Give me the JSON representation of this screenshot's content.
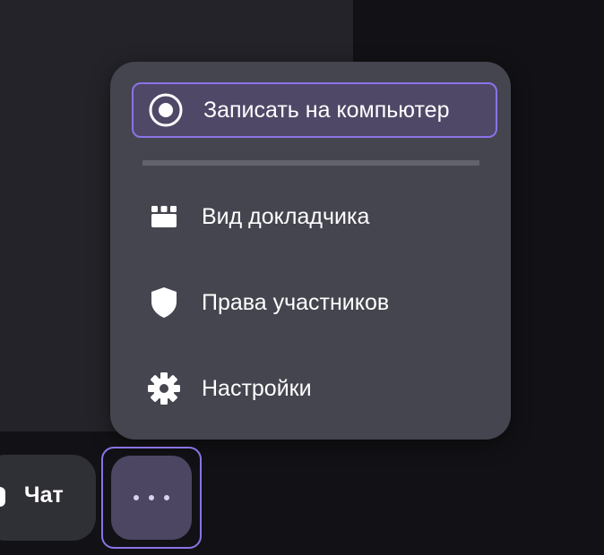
{
  "menu": {
    "items": [
      {
        "label": "Записать на компьютер",
        "icon": "record-icon",
        "active": true
      },
      {
        "label": "Вид докладчика",
        "icon": "speaker-view-icon"
      },
      {
        "label": "Права участников",
        "icon": "shield-icon"
      },
      {
        "label": "Настройки",
        "icon": "gear-icon"
      }
    ]
  },
  "toolbar": {
    "chat_label": "Чат",
    "more_icon": "more-dots-icon"
  },
  "colors": {
    "accent": "#8b73e8",
    "menu_bg": "#45454f",
    "active_bg": "#4f4867",
    "page_bg": "#121216",
    "panel_bg": "#232329"
  }
}
